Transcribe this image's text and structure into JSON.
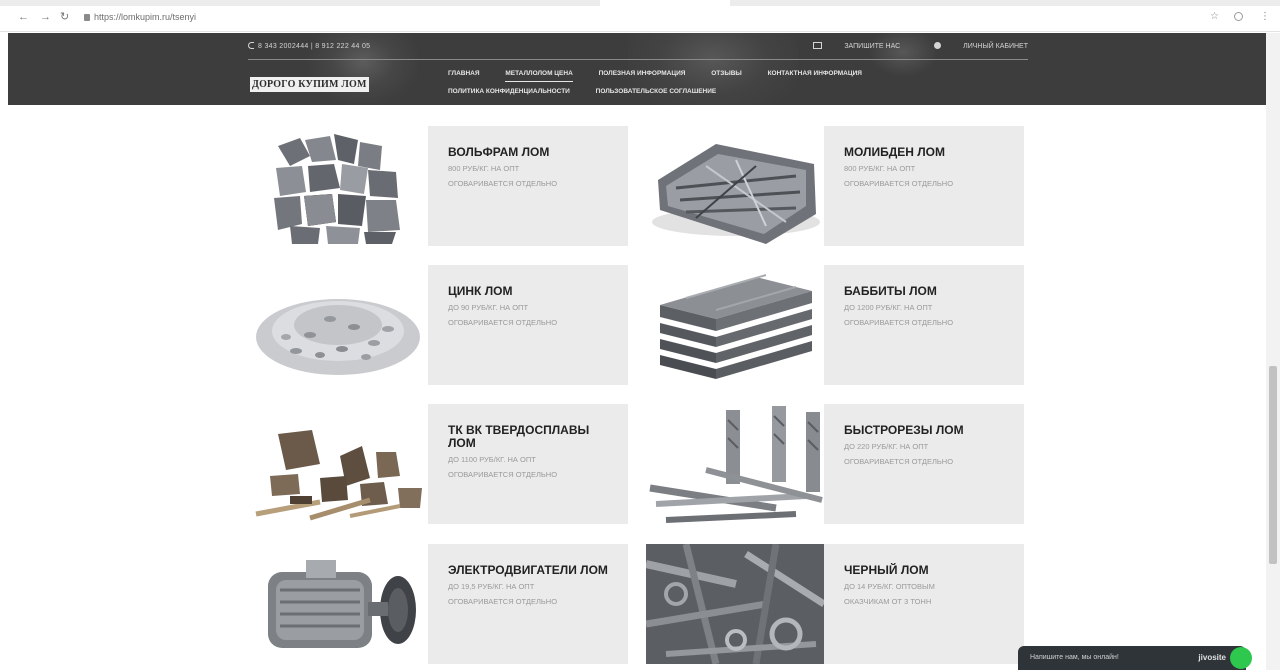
{
  "browser": {
    "url": "https://lomkupim.ru/tsenyi",
    "back_glyph": "←",
    "forward_glyph": "→",
    "reload_glyph": "↻",
    "star_glyph": "☆",
    "menu_glyph": "⋮",
    "icons": [
      "back-icon",
      "forward-icon",
      "reload-icon",
      "lock-icon",
      "star-icon",
      "extension-icon",
      "menu-icon"
    ]
  },
  "header": {
    "phones": "8 343 2002444  |  8 912 222 44 05",
    "top_links": [
      "ЗАПИШИТЕ НАС",
      "ЛИЧНЫЙ КАБИНЕТ"
    ],
    "logo": "ДОРОГО КУПИМ ЛОМ",
    "nav_row1": [
      "Главная",
      "Металлолом цена",
      "Полезная информация",
      "Отзывы",
      "Контактная информация"
    ],
    "nav_row2": [
      "Политика конфиденциальности",
      "Пользовательское соглашение"
    ],
    "active_nav": "Металлолом цена"
  },
  "products": [
    {
      "name": "ВОЛЬФРАМ ЛОМ",
      "price": "800 РУБ/КГ. НА ОПТ",
      "note": "ОГОВАРИВАЕТСЯ ОТДЕЛЬНО"
    },
    {
      "name": "МОЛИБДЕН ЛОМ",
      "price": "800 РУБ/КГ. НА ОПТ",
      "note": "ОГОВАРИВАЕТСЯ ОТДЕЛЬНО"
    },
    {
      "name": "ЦИНК ЛОМ",
      "price": "ДО 90 РУБ/КГ. НА ОПТ",
      "note": "ОГОВАРИВАЕТСЯ ОТДЕЛЬНО"
    },
    {
      "name": "БАББИТЫ ЛОМ",
      "price": "ДО 1200 РУБ/КГ. НА ОПТ",
      "note": "ОГОВАРИВАЕТСЯ ОТДЕЛЬНО"
    },
    {
      "name": "ТК ВК ТВЕРДОСПЛАВЫ ЛОМ",
      "price": "ДО 1100 РУБ/КГ. НА ОПТ",
      "note": "ОГОВАРИВАЕТСЯ ОТДЕЛЬНО"
    },
    {
      "name": "БЫСТРОРЕЗЫ ЛОМ",
      "price": "ДО 220 РУБ/КГ. НА ОПТ",
      "note": "ОГОВАРИВАЕТСЯ ОТДЕЛЬНО"
    },
    {
      "name": "ЭЛЕКТРОДВИГАТЕЛИ ЛОМ",
      "price": "ДО 19,5 РУБ/КГ. НА ОПТ",
      "note": "ОГОВАРИВАЕТСЯ ОТДЕЛЬНО"
    },
    {
      "name": "ЧЕРНЫЙ ЛОМ",
      "price": "ДО 14 РУБ/КГ. ОПТОВЫМ",
      "note": "ОКАЗЧИКАМ ОТ 3 ТОНН"
    }
  ],
  "chat": {
    "text": "Напишите нам, мы онлайн!",
    "brand": "jivosite"
  },
  "colors": {
    "header_bg": "#3d3d3d",
    "card_bg": "#ebebeb",
    "chat_bg": "#2f3439",
    "chat_dot": "#2dc84d"
  }
}
